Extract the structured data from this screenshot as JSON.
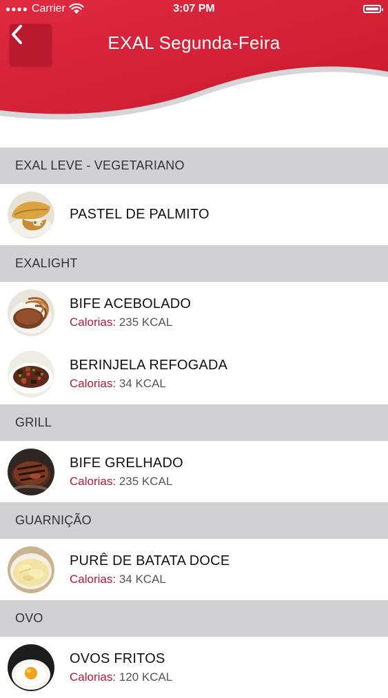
{
  "status": {
    "carrier": "Carrier",
    "time": "3:07 PM"
  },
  "header": {
    "title": "EXAL Segunda-Feira",
    "back_icon": "chevron-left-icon",
    "accent": "#d4243a"
  },
  "calories_label": "Calorias:",
  "sections": [
    {
      "title": "EXAL LEVE - VEGETARIANO",
      "items": [
        {
          "name": "PASTEL DE PALMITO"
        }
      ]
    },
    {
      "title": "EXALIGHT",
      "items": [
        {
          "name": "BIFE ACEBOLADO",
          "calories": "235 KCAL"
        },
        {
          "name": "BERINJELA REFOGADA",
          "calories": "34 KCAL"
        }
      ]
    },
    {
      "title": "GRILL",
      "items": [
        {
          "name": "BIFE GRELHADO",
          "calories": "235 KCAL"
        }
      ]
    },
    {
      "title": "GUARNIÇÃO",
      "items": [
        {
          "name": "PURÊ DE BATATA DOCE",
          "calories": "34 KCAL"
        }
      ]
    },
    {
      "title": "OVO",
      "items": [
        {
          "name": "OVOS FRITOS",
          "calories": "120 KCAL"
        }
      ]
    }
  ]
}
